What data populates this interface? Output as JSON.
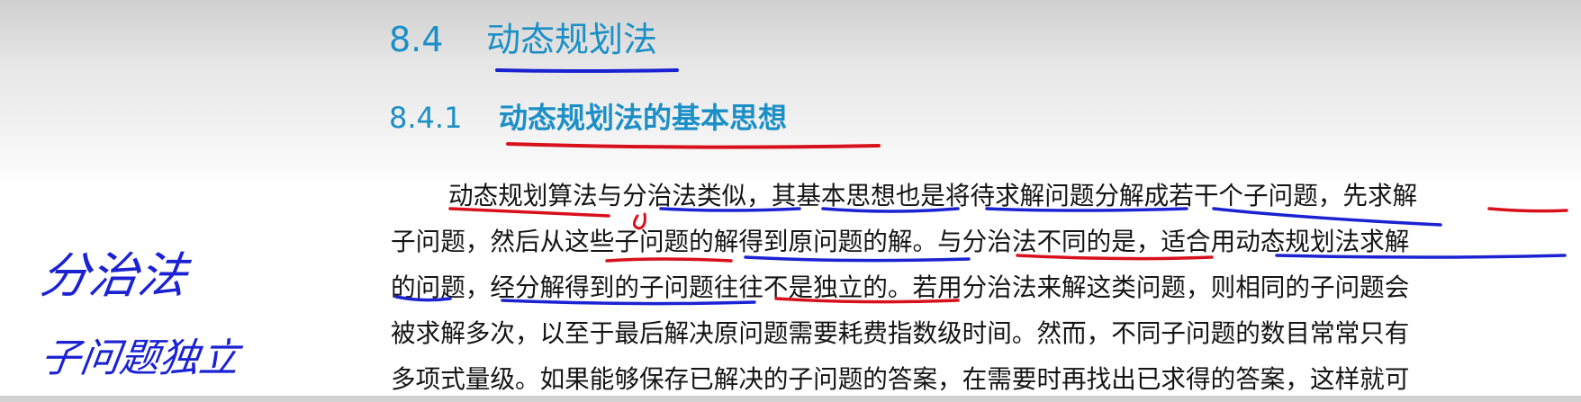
{
  "section": {
    "number": "8.4",
    "title": "动态规划法"
  },
  "subsection": {
    "number": "8.4.1",
    "title": "动态规划法的基本思想"
  },
  "paragraph": {
    "lines": [
      "动态规划算法与分治法类似，其基本思想也是将待求解问题分解成若干个子问题，先求解",
      "子问题，然后从这些子问题的解得到原问题的解。与分治法不同的是，适合用动态规划法求解",
      "的问题，经分解得到的子问题往往不是独立的。若用分治法来解这类问题，则相同的子问题会",
      "被求解多次，以至于最后解决原问题需要耗费指数级时间。然而，不同子问题的数目常常只有",
      "多项式量级。如果能够保存已解决的子问题的答案，在需要时再找出已求得的答案，这样就可"
    ]
  },
  "handwritten_notes": {
    "line1": "分治法",
    "line2": "子问题独立"
  },
  "annotation_colors": {
    "red": "#d8101c",
    "blue": "#1a22d2"
  }
}
